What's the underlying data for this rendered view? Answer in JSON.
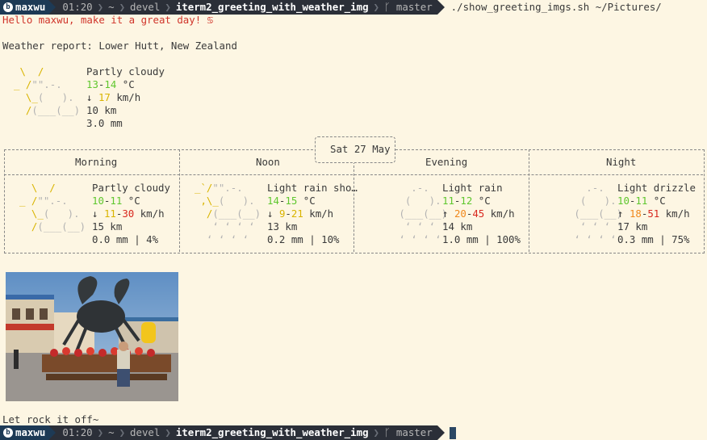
{
  "prompt": {
    "user": "maxwu",
    "time": "01:20",
    "home": "~",
    "dir1": "devel",
    "dir2": "iterm2_greeting_with_weather_img",
    "branch": "master",
    "branch_icon": "git-branch-icon",
    "logo_icon": "b-logo-icon",
    "command": "./show_greeting_imgs.sh ~/Pictures/"
  },
  "greeting": "Hello maxwu, make it a great day! ♋",
  "weather": {
    "report_label": "Weather report: Lower Hutt, New Zealand",
    "current": {
      "condition": "Partly cloudy",
      "temp_lo": "13",
      "temp_hi": "14",
      "temp_unit": " °C",
      "wind_arrow": "↓",
      "wind": "17",
      "wind_unit": " km/h",
      "visibility": "10 km",
      "precip": "3.0 mm"
    },
    "date": "Sat 27 May",
    "periods": [
      {
        "name": "Morning",
        "condition": "Partly cloudy",
        "t1": "10",
        "t2": "11",
        "arrow": "↓",
        "w1": "11",
        "w2": "30",
        "vis": "15 km",
        "precip": "0.0 mm | 4%"
      },
      {
        "name": "Noon",
        "condition": "Light rain sho…",
        "t1": "14",
        "t2": "15",
        "arrow": "↓",
        "w1": "9",
        "w2": "21",
        "vis": "13 km",
        "precip": "0.2 mm | 10%"
      },
      {
        "name": "Evening",
        "condition": "Light rain",
        "t1": "11",
        "t2": "12",
        "arrow": "↑",
        "w1": "20",
        "w2": "45",
        "vis": "14 km",
        "precip": "1.0 mm | 100%"
      },
      {
        "name": "Night",
        "condition": "Light drizzle",
        "t1": "10",
        "t2": "11",
        "arrow": "↑",
        "w1": "18",
        "w2": "51",
        "vis": "17 km",
        "precip": "0.3 mm | 75%"
      }
    ],
    "colors": {
      "temp": "#5fc72e",
      "wind_low": "#d9b400",
      "wind_high": "#d8281e",
      "sun": "#d9b400",
      "cloud": "#b3b3b3"
    }
  },
  "photo": {
    "subject": "man sitting on bench in front of giant crab statue"
  },
  "footer": "Let rock it off~"
}
